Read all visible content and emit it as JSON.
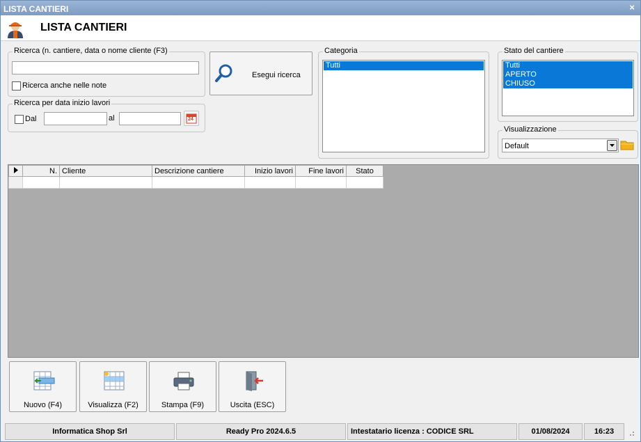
{
  "window": {
    "title": "LISTA CANTIERI",
    "close": "×"
  },
  "header": {
    "title": "LISTA CANTIERI"
  },
  "search": {
    "legend": "Ricerca (n. cantiere, data o nome cliente (F3)",
    "value": "",
    "notes_label": "Ricerca anche nelle note",
    "button_label": "Esegui ricerca"
  },
  "date_search": {
    "legend": "Ricerca per data inizio lavori",
    "from_label": "Dal",
    "to_label": "al",
    "from_value": "",
    "to_value": "",
    "calendar_day": "24"
  },
  "category": {
    "legend": "Categoria",
    "items": [
      {
        "label": "Tutti",
        "selected": true
      }
    ]
  },
  "state": {
    "legend": "Stato del cantiere",
    "items": [
      {
        "label": "Tutti",
        "selected": true
      },
      {
        "label": "APERTO",
        "selected": true
      },
      {
        "label": "CHIUSO",
        "selected": true
      }
    ]
  },
  "view": {
    "legend": "Visualizzazione",
    "selected": "Default"
  },
  "grid": {
    "columns": [
      "N.",
      "Cliente",
      "Descrizione cantiere",
      "Inizio lavori",
      "Fine lavori",
      "Stato"
    ],
    "rows": []
  },
  "buttons": {
    "new": "Nuovo (F4)",
    "view": "Visualizza (F2)",
    "print": "Stampa (F9)",
    "exit": "Uscita (ESC)"
  },
  "status": {
    "company": "Informatica Shop Srl",
    "version": "Ready Pro 2024.6.5",
    "license": "Intestatario licenza : CODICE SRL",
    "date": "01/08/2024",
    "time": "16:23"
  },
  "colors": {
    "selection": "#0a78d6",
    "titlebar": "#8aa8cf",
    "grid_bg": "#ababab"
  }
}
